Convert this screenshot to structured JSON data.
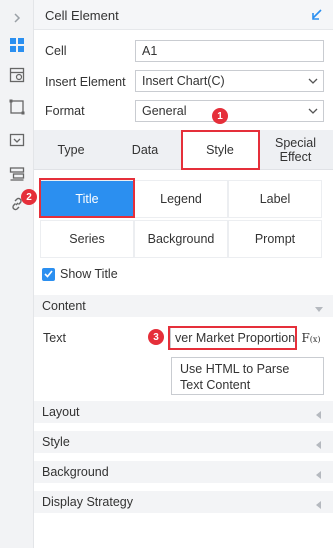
{
  "header": {
    "title": "Cell Element"
  },
  "form": {
    "cell_label": "Cell",
    "cell_value": "A1",
    "insert_label": "Insert Element",
    "insert_value": "Insert Chart(C)",
    "format_label": "Format",
    "format_value": "General"
  },
  "tabs": [
    {
      "label": "Type"
    },
    {
      "label": "Data"
    },
    {
      "label": "Style",
      "active": true
    },
    {
      "label": "Special Effect"
    }
  ],
  "style_buttons": [
    {
      "label": "Title",
      "active": true
    },
    {
      "label": "Legend"
    },
    {
      "label": "Label"
    },
    {
      "label": "Series"
    },
    {
      "label": "Background"
    },
    {
      "label": "Prompt"
    }
  ],
  "show_title": {
    "label": "Show Title",
    "checked": true
  },
  "sections": {
    "content": "Content",
    "layout": "Layout",
    "style": "Style",
    "background": "Background",
    "display": "Display Strategy"
  },
  "content": {
    "text_label": "Text",
    "text_value": "ver Market Proportion",
    "fx_label": "Fx",
    "parse_button": "Use HTML to Parse Text Content"
  },
  "callouts": {
    "one": "1",
    "two": "2",
    "three": "3"
  },
  "colors": {
    "accent": "#2b8ff0",
    "callout": "#e52f3a"
  }
}
